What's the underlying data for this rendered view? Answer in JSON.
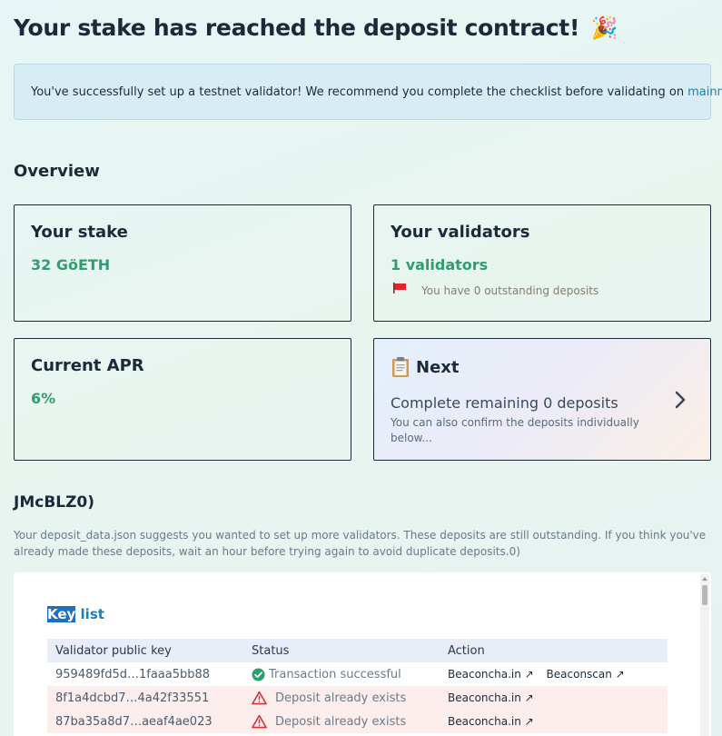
{
  "page": {
    "title": "Your stake has reached the deposit contract!",
    "title_emoji": "🎉"
  },
  "alert": {
    "text": "You've successfully set up a testnet validator! We recommend you complete the checklist before validating on",
    "link_label": "mainnet",
    "link_arrow": "↗"
  },
  "overview": {
    "heading": "Overview",
    "stake": {
      "title": "Your stake",
      "value": "32 GöETH"
    },
    "validators": {
      "title": "Your validators",
      "value": "1 validators",
      "outstanding": "You have 0 outstanding deposits",
      "flag_color": "#e0242c"
    },
    "apr": {
      "title": "Current APR",
      "value": "6%"
    },
    "next": {
      "title": "Next",
      "main": "Complete remaining 0 deposits",
      "sub": "You can also confirm the deposits individually below..."
    }
  },
  "deposits_section": {
    "heading": "JMcBLZ0)",
    "description": "Your deposit_data.json suggests you wanted to set up more validators. These deposits are still outstanding. If you think you've already made these deposits, wait an hour before trying again to avoid duplicate deposits.0)"
  },
  "keylist": {
    "title_selected": "Key",
    "title_rest": " list",
    "columns": [
      "Validator public key",
      "Status",
      "Action"
    ],
    "rows": [
      {
        "key": "959489fd5d…1faaa5bb88",
        "status": "Transaction successful",
        "state": "success",
        "actions": [
          "Beaconcha.in ↗",
          "Beaconscan ↗"
        ]
      },
      {
        "key": "8f1a4dcbd7…4a42f33551",
        "status": "Deposit already exists",
        "state": "error",
        "actions": [
          "Beaconcha.in ↗"
        ]
      },
      {
        "key": "87ba35a8d7…aeaf4ae023",
        "status": "Deposit already exists",
        "state": "error",
        "actions": [
          "Beaconcha.in ↗"
        ]
      }
    ]
  },
  "colors": {
    "accent_green": "#2f9e6e",
    "link_blue": "#1e7fb4",
    "error_row": "#fdeeee",
    "warning_red": "#d8303a"
  },
  "icons": [
    "party-popper-icon",
    "flag-icon",
    "clipboard-icon",
    "chevron-right-icon",
    "check-circle-icon",
    "warning-icon",
    "external-link-icon"
  ]
}
